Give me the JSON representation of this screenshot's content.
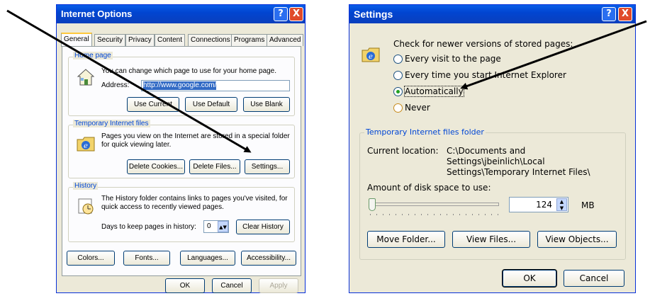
{
  "left_dialog": {
    "title": "Internet Options",
    "help_label": "?",
    "close_label": "X",
    "tabs": [
      "General",
      "Security",
      "Privacy",
      "Content",
      "Connections",
      "Programs",
      "Advanced"
    ],
    "home_page": {
      "group_label": "Home page",
      "description": "You can change which page to use for your home page.",
      "address_label": "Address:",
      "address_value": "http://www.google.com/",
      "use_current": "Use Current",
      "use_default": "Use Default",
      "use_blank": "Use Blank"
    },
    "temp_files": {
      "group_label": "Temporary Internet files",
      "description": "Pages you view on the Internet are stored in a special folder for quick viewing later.",
      "delete_cookies": "Delete Cookies...",
      "delete_files": "Delete Files...",
      "settings": "Settings..."
    },
    "history": {
      "group_label": "History",
      "description": "The History folder contains links to pages you've visited, for quick access to recently viewed pages.",
      "days_label": "Days to keep pages in history:",
      "days_value": "0",
      "clear_history": "Clear History"
    },
    "bottom_buttons": {
      "colors": "Colors...",
      "fonts": "Fonts...",
      "languages": "Languages...",
      "accessibility": "Accessibility..."
    },
    "ok": "OK",
    "cancel": "Cancel",
    "apply": "Apply"
  },
  "right_dialog": {
    "title": "Settings",
    "help_label": "?",
    "close_label": "X",
    "check_label": "Check for newer versions of stored pages:",
    "options": [
      "Every visit to the page",
      "Every time you start Internet Explorer",
      "Automatically",
      "Never"
    ],
    "selected_option": "Automatically",
    "folder_group_label": "Temporary Internet files folder",
    "current_location_label": "Current location:",
    "current_location_line1": "C:\\Documents and",
    "current_location_line2": "Settings\\jbeinlich\\Local",
    "current_location_line3": "Settings\\Temporary Internet Files\\",
    "disk_space_label": "Amount of disk space to use:",
    "disk_space_value": "124",
    "disk_space_unit": "MB",
    "move_folder": "Move Folder...",
    "view_files": "View Files...",
    "view_objects": "View Objects...",
    "ok": "OK",
    "cancel": "Cancel"
  },
  "colors": {
    "title_bar": "#0a5ee8",
    "dialog_bg": "#ece9d8",
    "group_label": "#0046d5",
    "arrow": "#000000"
  }
}
